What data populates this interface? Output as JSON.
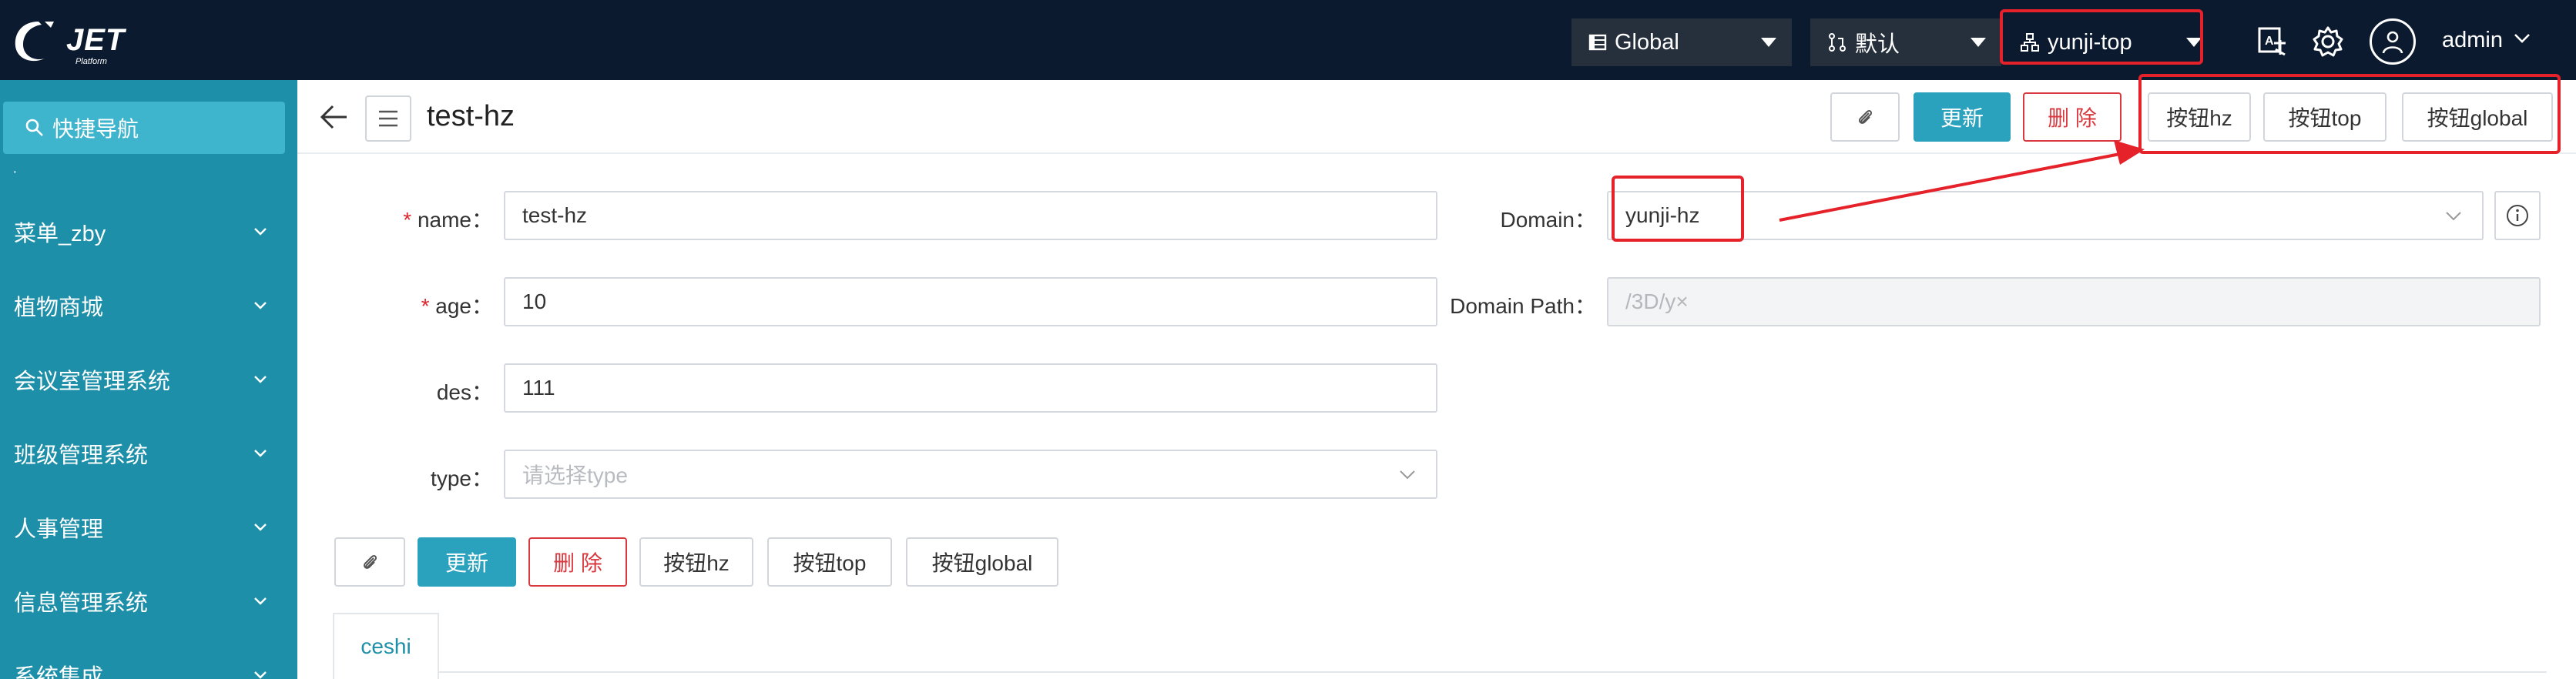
{
  "brand": {
    "name": "JET",
    "sub": "Platform"
  },
  "topbar": {
    "selects": [
      {
        "label": "Global"
      },
      {
        "label": "默认"
      },
      {
        "label": "yunji-top"
      }
    ],
    "user": "admin"
  },
  "sidebar": {
    "quicknav": "快捷导航",
    "dot": "·",
    "items": [
      {
        "label": "菜单_zby"
      },
      {
        "label": "植物商城"
      },
      {
        "label": "会议室管理系统"
      },
      {
        "label": "班级管理系统"
      },
      {
        "label": "人事管理"
      },
      {
        "label": "信息管理系统"
      },
      {
        "label": "系统集成"
      }
    ]
  },
  "header": {
    "title": "test-hz",
    "buttons": {
      "update": "更新",
      "delete": "删 除",
      "hz": "按钮hz",
      "top": "按钮top",
      "global": "按钮global"
    }
  },
  "form": {
    "name": {
      "label": "name",
      "value": "test-hz"
    },
    "age": {
      "label": "age",
      "value": "10"
    },
    "des": {
      "label": "des",
      "value": "111"
    },
    "type": {
      "label": "type",
      "placeholder": "请选择type"
    },
    "domain": {
      "label": "Domain",
      "value": "yunji-hz"
    },
    "domain_path": {
      "label": "Domain Path",
      "value": "/3D/y×"
    },
    "colon": "："
  },
  "bottom_buttons": {
    "update": "更新",
    "delete": "删 除",
    "hz": "按钮hz",
    "top": "按钮top",
    "global": "按钮global"
  },
  "tabs": [
    {
      "label": "ceshi"
    }
  ],
  "colors": {
    "topbar": "#0b1a2e",
    "sidebar": "#1e8fa8",
    "primary": "#2ba2bd",
    "danger": "#d9383e",
    "annotation": "#e5222a"
  }
}
